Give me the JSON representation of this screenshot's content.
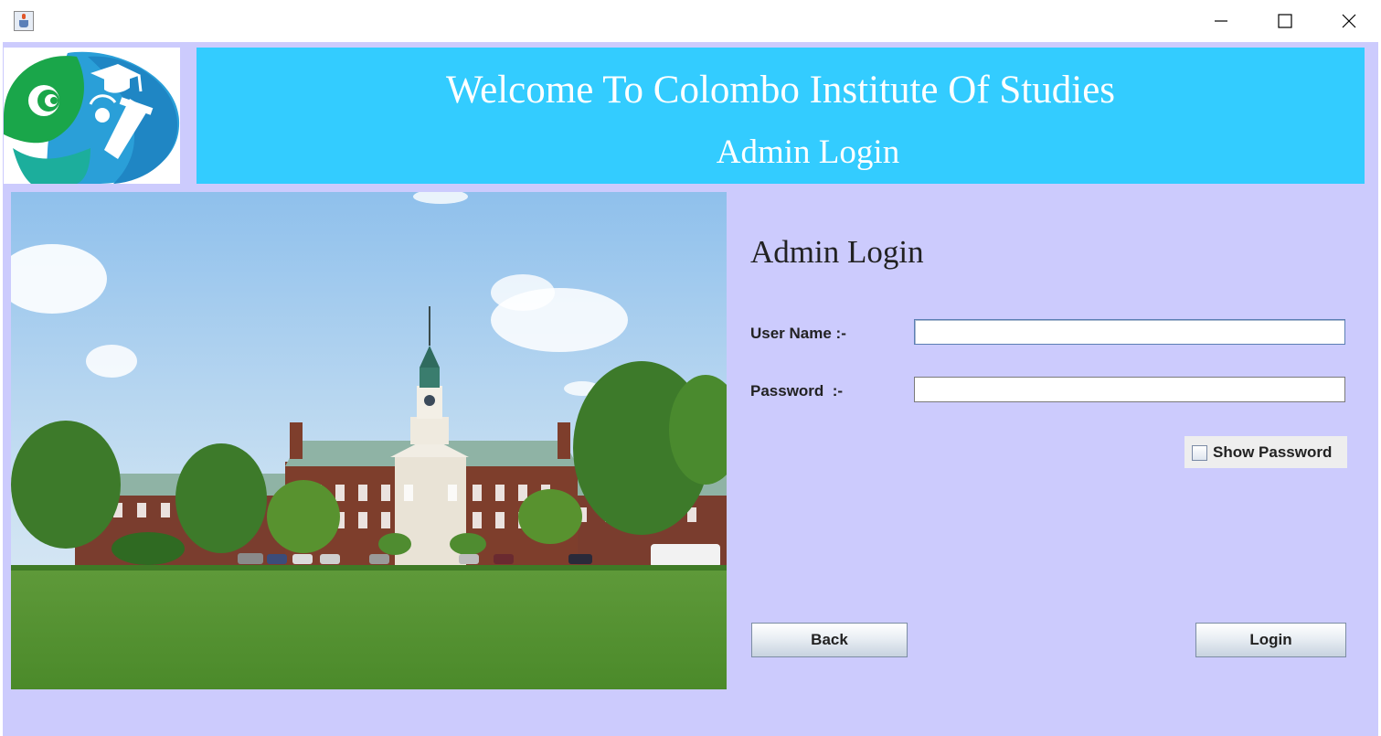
{
  "window": {
    "title": "",
    "controls": {
      "minimize_icon": "minimize-icon",
      "maximize_icon": "maximize-icon",
      "close_icon": "close-icon"
    }
  },
  "header": {
    "title": "Welcome To Colombo Institute Of Studies",
    "subtitle": "Admin Login",
    "logo": "graduation-cap-logo"
  },
  "form": {
    "heading": "Admin Login",
    "username_label": "User Name :-",
    "username_value": "",
    "password_label": "Password  :-",
    "password_value": "",
    "show_password_label": "Show Password",
    "show_password_checked": false,
    "back_label": "Back",
    "login_label": "Login"
  },
  "colors": {
    "background": "#cccbfd",
    "banner": "#33ccff",
    "banner_text": "#ffffff",
    "logo_green": "#1aa64a",
    "logo_blue": "#2a9fd8"
  }
}
